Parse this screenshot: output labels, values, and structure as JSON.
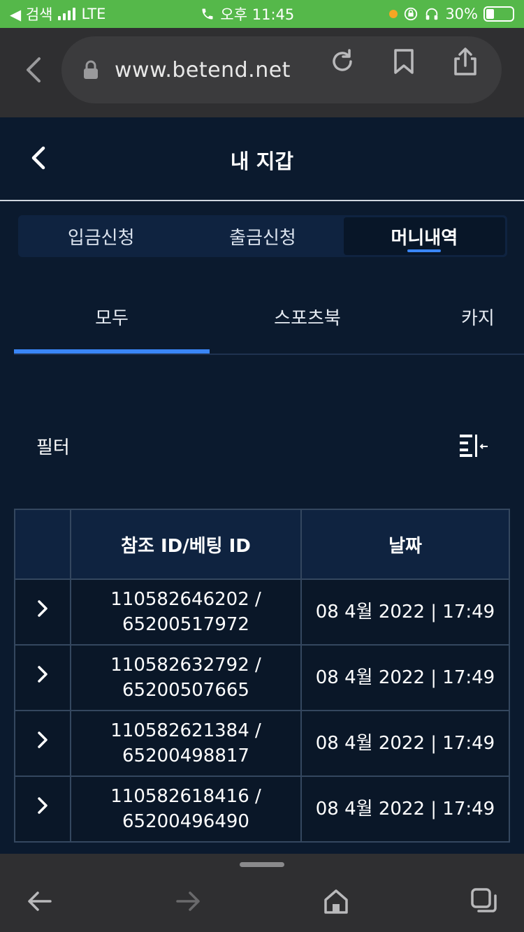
{
  "status_bar": {
    "back_app": "◀ 검색",
    "network": "LTE",
    "time": "오후 11:45",
    "battery": "30%",
    "battery_level": 0.3
  },
  "browser": {
    "url": "www.betend.net"
  },
  "header": {
    "title": "내 지갑"
  },
  "segment_tabs": [
    {
      "label": "입금신청",
      "active": false
    },
    {
      "label": "출금신청",
      "active": false
    },
    {
      "label": "머니내역",
      "active": true
    }
  ],
  "sub_tabs": [
    {
      "label": "모두",
      "active": true
    },
    {
      "label": "스포츠북",
      "active": false
    },
    {
      "label": "카지",
      "active": false
    }
  ],
  "filter": {
    "label": "필터"
  },
  "table": {
    "headers": [
      "",
      "참조 ID/베팅 ID",
      "날짜"
    ],
    "rows": [
      {
        "id_line1": "110582646202 /",
        "id_line2": "65200517972",
        "date": "08 4월 2022 | 17:49"
      },
      {
        "id_line1": "110582632792 /",
        "id_line2": "65200507665",
        "date": "08 4월 2022 | 17:49"
      },
      {
        "id_line1": "110582621384 /",
        "id_line2": "65200498817",
        "date": "08 4월 2022 | 17:49"
      },
      {
        "id_line1": "110582618416 /",
        "id_line2": "65200496490",
        "date": "08 4월 2022 | 17:49"
      }
    ]
  },
  "colors": {
    "background": "#0b1a2e",
    "accent": "#3a86f7",
    "status_bar": "#55b84a",
    "browser_chrome": "#2f2f31"
  },
  "icons": {
    "browser_back": "chevron-left-icon",
    "lock": "lock-icon",
    "reload": "reload-icon",
    "bookmark": "bookmark-icon",
    "share": "share-icon",
    "filter": "filter-collapse-icon",
    "row_expand": "chevron-right-icon",
    "nav_back": "arrow-left-icon",
    "nav_forward": "arrow-right-icon",
    "home": "home-icon",
    "tabs": "tabs-icon"
  }
}
